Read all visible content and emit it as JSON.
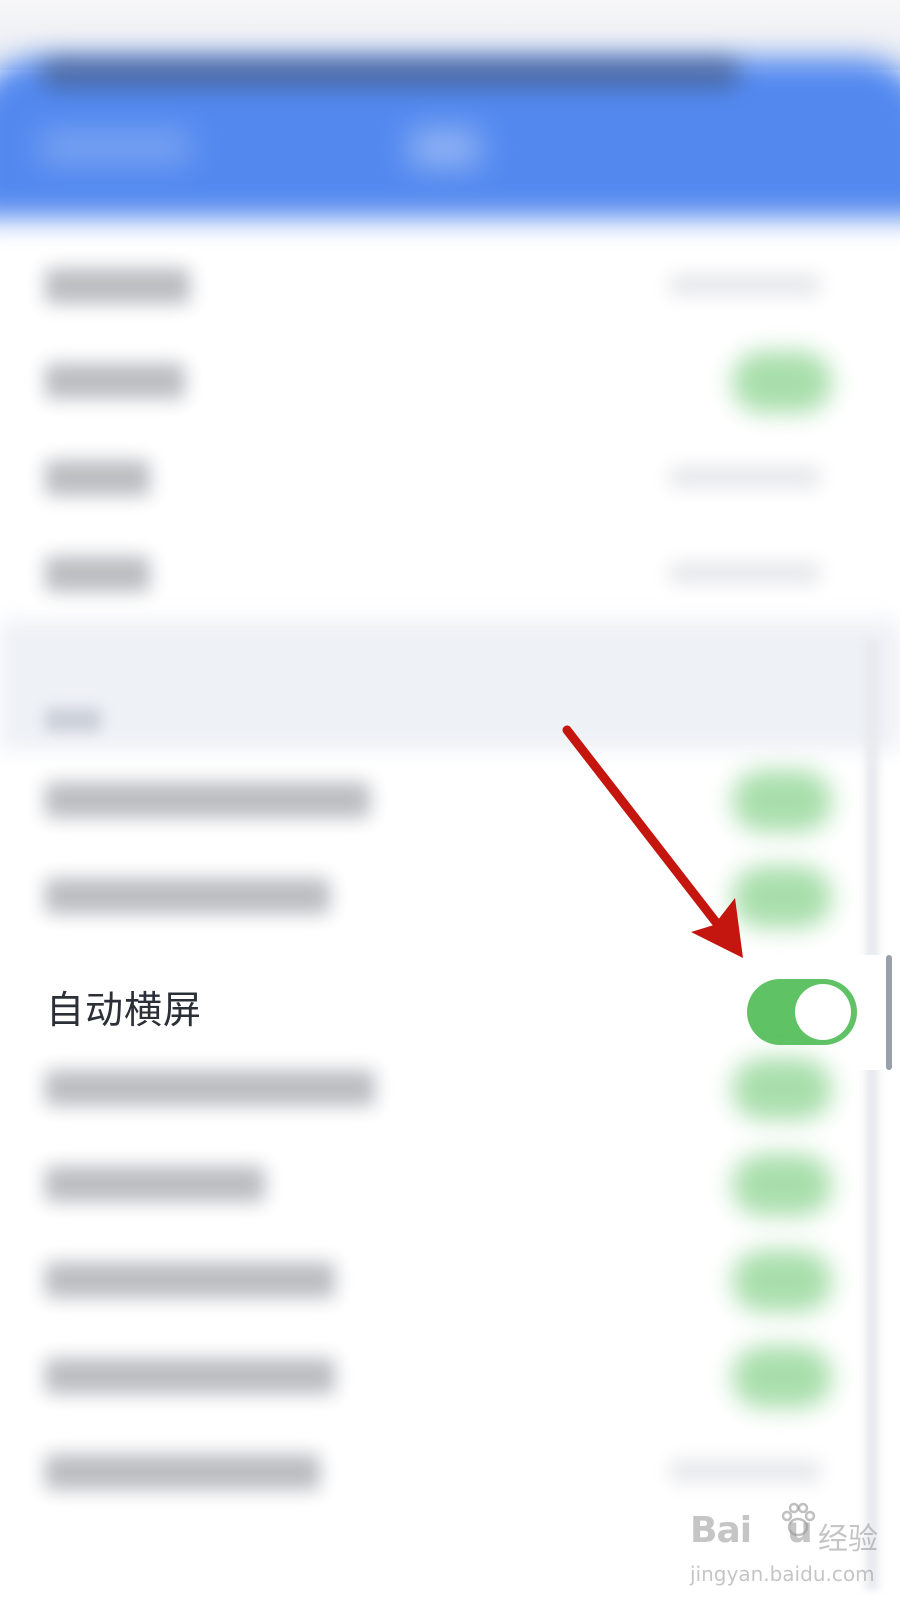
{
  "settings": {
    "auto_rotate": {
      "label": "自动横屏",
      "enabled": true
    }
  },
  "colors": {
    "top_bar": "#5389ef",
    "toggle_on": "#5fc264",
    "annotation_arrow": "#c4150f"
  },
  "watermark": {
    "brand": "Bai",
    "brand_suffix": "u",
    "cn": "经验",
    "url": "jingyan.baidu.com"
  }
}
